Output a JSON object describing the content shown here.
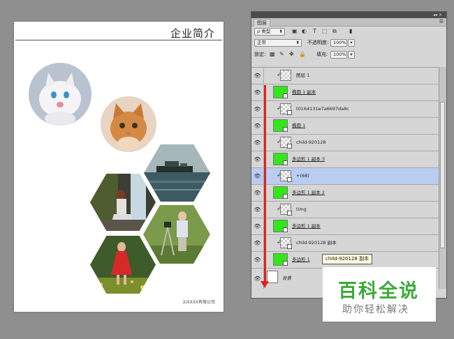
{
  "document": {
    "title": "企业简介",
    "footer": "2/XXXX有限公司",
    "photos": [
      "white-kitten",
      "orange-kitten",
      "ship-at-sea",
      "girl-by-waterfall",
      "boy-with-camera",
      "girl-in-red-dress"
    ]
  },
  "panel": {
    "tab": "图层",
    "controls": "◂◂ ×",
    "filter_kind": "ρ 类型",
    "blend_mode": "正常",
    "opacity_label": "不透明度:",
    "opacity_value": "100%",
    "lock_label": "锁定:",
    "fill_label": "填充:",
    "fill_value": "100%",
    "layers": [
      {
        "name": "图层 1",
        "thumb": "check"
      },
      {
        "name": "椭圆 1 副本",
        "thumb": "green"
      },
      {
        "name": "t0164131e7a6697da8c",
        "thumb": "check"
      },
      {
        "name": "椭圆 1",
        "thumb": "green"
      },
      {
        "name": "child-920128",
        "thumb": "check"
      },
      {
        "name": "多边形 1 副本 3",
        "thumb": "green"
      },
      {
        "name": "+(68)",
        "thumb": "check"
      },
      {
        "name": "多边形 1 副本 2",
        "thumb": "green"
      },
      {
        "name": "timg",
        "thumb": "check"
      },
      {
        "name": "多边形 1 副本",
        "thumb": "green"
      },
      {
        "name": "child-920128 副本",
        "thumb": "check"
      },
      {
        "name": "多边形 1",
        "thumb": "green"
      },
      {
        "name": "背景",
        "thumb": "white"
      }
    ]
  },
  "tooltip": "child-920128 副本",
  "watermark": {
    "title": "百科全说",
    "subtitle": "助你轻松解决"
  },
  "colors": {
    "shape_thumb": "#33e61a",
    "arrow": "#e02020",
    "selected": "#b8cdf0",
    "watermark": "#3daa3a"
  }
}
